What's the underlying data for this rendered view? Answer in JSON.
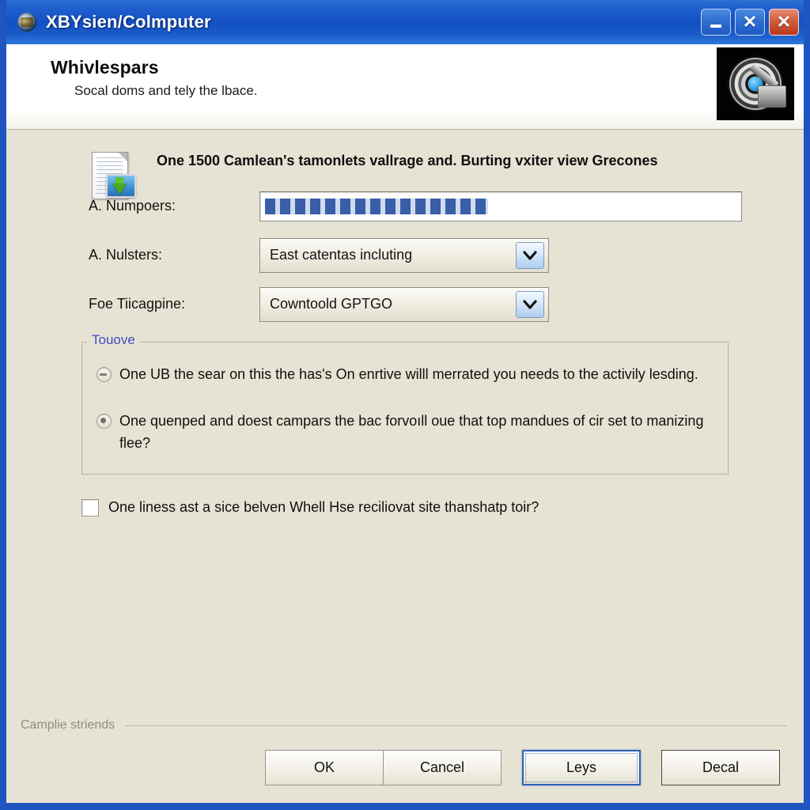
{
  "window": {
    "title": "XBYsien/Colmputer",
    "title_icon": "globe-computer-icon",
    "controls": [
      {
        "name": "minimize-button",
        "glyph": "_",
        "color": "#2f6fd0"
      },
      {
        "name": "maximize-button",
        "glyph": "✕",
        "color": "#2f6fd0"
      },
      {
        "name": "close-button",
        "glyph": "✕",
        "color": "#c0441f"
      }
    ]
  },
  "header": {
    "title": "Whivlespars",
    "subtitle": "Socal doms and tely the lbace.",
    "logo_icon": "disc-drive-icon"
  },
  "intro": {
    "icon": "document-download-icon",
    "text": "One 1500 Camlean's tamonlets vallrage and. Burting vxiter view Grecones"
  },
  "form": {
    "fields": [
      {
        "label": "A. Numpoers:",
        "type": "textbox",
        "name": "numpoers-input",
        "value": "",
        "masked_selection": true
      },
      {
        "label": "A. Nulsters:",
        "type": "combobox",
        "name": "nulsters-select",
        "value": "East catentas incluting"
      },
      {
        "label": "Foe Tiicagpine:",
        "type": "combobox",
        "name": "tiicagpine-select",
        "value": "Cowntoold GPTGO"
      }
    ]
  },
  "group": {
    "legend": "Touove",
    "legend_color": "#3a4fc0",
    "options": [
      {
        "name": "radio-option-1",
        "state": "dash",
        "label": "One UB the sear on this the has's On enrtive willl merrated you needs to the activily lesding."
      },
      {
        "name": "radio-option-2",
        "state": "checked",
        "label": "One quenped and doest campars the bac forvoıll oue that top mandues of cir set to manizing flee?"
      }
    ]
  },
  "checkbox": {
    "name": "agreement-checkbox",
    "checked": false,
    "label": "One liness ast a sice belven Whell Hse reciliovat site thanshatp toir?"
  },
  "footer": {
    "note": "Camplie striends",
    "buttons": [
      {
        "name": "ok-button",
        "label": "OK",
        "focused": false
      },
      {
        "name": "cancel-button",
        "label": "Cancel",
        "focused": false
      },
      {
        "name": "leys-button",
        "label": "Leys",
        "focused": true
      },
      {
        "name": "decal-button",
        "label": "Decal",
        "focused": false
      }
    ]
  },
  "colors": {
    "titlebar": "#1350c4",
    "window_border": "#1e55c0",
    "body_background": "#e7e3d4",
    "accent_blue": "#3a4fc0",
    "selection_blue": "#2f55a4"
  }
}
